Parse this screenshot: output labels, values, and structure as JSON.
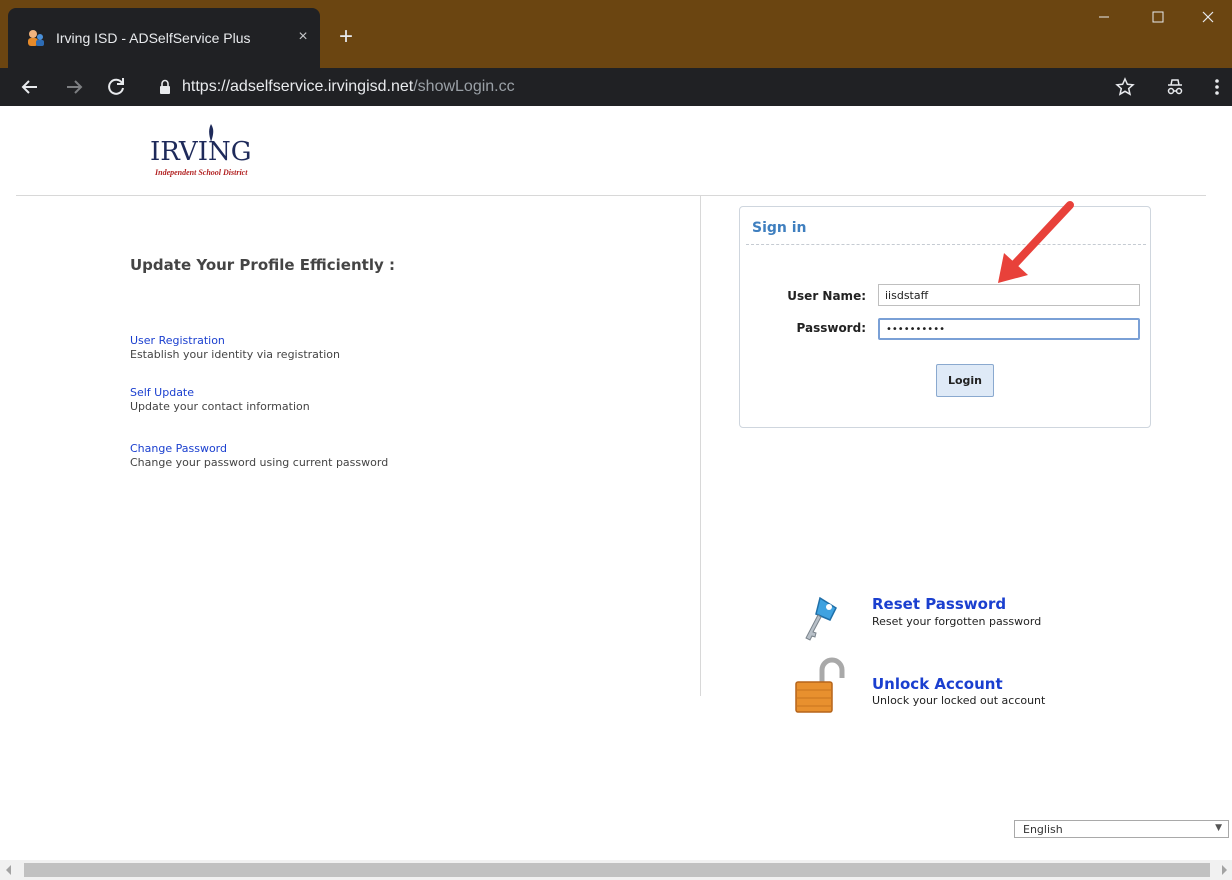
{
  "browser": {
    "tab_title": "Irving ISD - ADSelfService Plus",
    "tab_close": "×",
    "new_tab": "+",
    "url_main": "https://adselfservice.irvingisd.net",
    "url_path": "/showLogin.cc",
    "frame_color": "#6b4511",
    "toolbar_color": "#202124"
  },
  "logo": {
    "word": "IRVING",
    "subtitle": "Independent School District"
  },
  "profile": {
    "title": "Update Your Profile Efficiently :",
    "features": [
      {
        "link": "User Registration",
        "desc": "Establish your identity via registration"
      },
      {
        "link": "Self Update",
        "desc": "Update your contact information"
      },
      {
        "link": "Change Password",
        "desc": "Change your password using current password"
      }
    ]
  },
  "signin": {
    "title": "Sign in",
    "username_label": "User Name:",
    "username_value": "iisdstaff",
    "password_label": "Password:",
    "password_value": "••••••••••",
    "login_label": "Login"
  },
  "quick_links": [
    {
      "title": "Reset Password",
      "desc": "Reset your forgotten password",
      "icon": "key-icon"
    },
    {
      "title": "Unlock Account",
      "desc": "Unlock your locked out account",
      "icon": "padlock-icon"
    }
  ],
  "language": {
    "selected": "English"
  },
  "colors": {
    "link_blue": "#1a3fcf",
    "signin_title": "#3f7fbf",
    "arrow_red": "#e8413a"
  }
}
